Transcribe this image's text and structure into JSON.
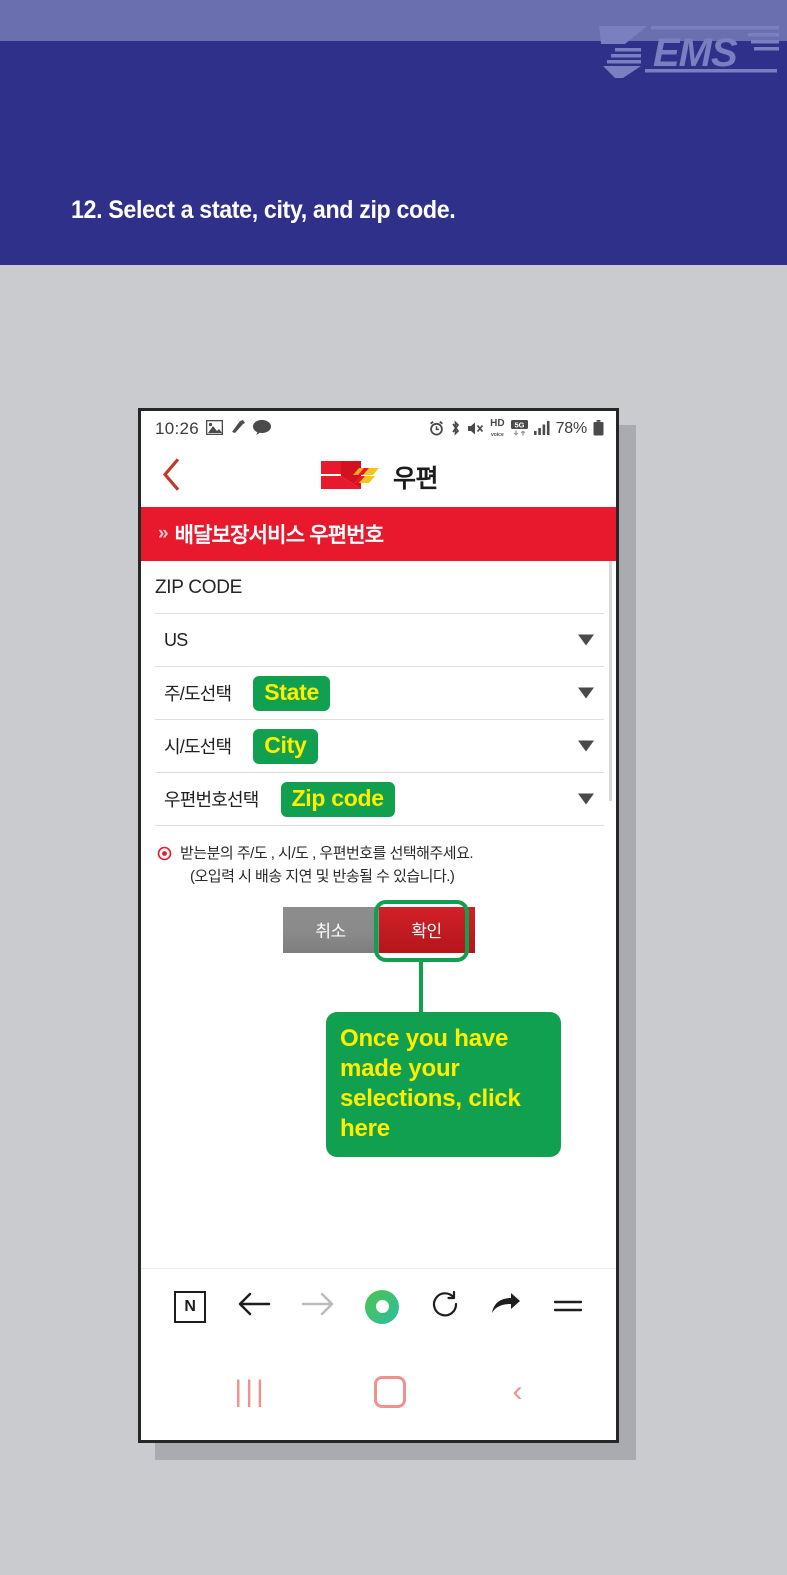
{
  "header": {
    "logo_text": "EMS",
    "step_title": "12. Select a state, city, and zip code.",
    "band_light_color": "#6a6fb0",
    "band_dark_color": "#2e3089"
  },
  "phone": {
    "statusbar": {
      "time": "10:26",
      "left_icons": [
        "image-icon",
        "app-icon",
        "chat-icon"
      ],
      "right_icons": [
        "alarm-icon",
        "bluetooth-icon",
        "mute-icon",
        "hd-voice-icon",
        "five-g-icon",
        "signal-icon"
      ],
      "battery": "78%"
    },
    "appbar": {
      "back_label": "‹",
      "logo_name": "korea-post-logo",
      "title": "우편"
    },
    "banner": {
      "arrows": "»",
      "text": "배달보장서비스 우편번호",
      "color": "#e8192c"
    },
    "form": {
      "section_label": "ZIP CODE",
      "fields": [
        {
          "label": "US",
          "badge": "",
          "type": "country"
        },
        {
          "label": "주/도선택",
          "badge": "State",
          "type": "state"
        },
        {
          "label": "시/도선택",
          "badge": "City",
          "type": "city"
        },
        {
          "label": "우편번호선택",
          "badge": "Zip code",
          "type": "zipcode"
        }
      ]
    },
    "help": {
      "line1": "받는분의 주/도 , 시/도 , 우편번호를 선택해주세요.",
      "line2": "(오입력 시 배송 지연 및 반송될 수 있습니다.)"
    },
    "buttons": {
      "cancel": "취소",
      "confirm": "확인"
    },
    "callout": {
      "text": "Once you have made your selections, click here",
      "bg_color": "#11a050",
      "text_color": "#ffee00"
    },
    "browser_nav": {
      "naver_label": "N",
      "items": [
        "naver-home-icon",
        "back-arrow-icon",
        "forward-arrow-icon",
        "home-circle-icon",
        "reload-icon",
        "share-icon",
        "menu-icon"
      ]
    },
    "system_nav": {
      "items": [
        "recents-icon",
        "home-icon",
        "back-icon"
      ]
    }
  }
}
